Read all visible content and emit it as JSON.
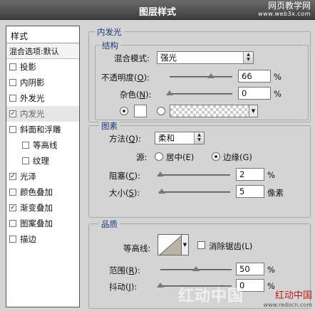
{
  "window": {
    "title": "图层样式"
  },
  "watermark_top": {
    "line1": "网页教学网",
    "line2": "www.web3x.com"
  },
  "left_panel": {
    "header": "样式",
    "blend_options": "混合选项:默认",
    "items": [
      {
        "label": "投影",
        "checked": false,
        "sub": false
      },
      {
        "label": "内阴影",
        "checked": false,
        "sub": false
      },
      {
        "label": "外发光",
        "checked": false,
        "sub": false
      },
      {
        "label": "内发光",
        "checked": true,
        "sub": false,
        "selected": true
      },
      {
        "label": "斜面和浮雕",
        "checked": false,
        "sub": false
      },
      {
        "label": "等高线",
        "checked": false,
        "sub": true
      },
      {
        "label": "纹理",
        "checked": false,
        "sub": true
      },
      {
        "label": "光泽",
        "checked": true,
        "sub": false
      },
      {
        "label": "颜色叠加",
        "checked": false,
        "sub": false
      },
      {
        "label": "渐变叠加",
        "checked": true,
        "sub": false
      },
      {
        "label": "图案叠加",
        "checked": false,
        "sub": false
      },
      {
        "label": "描边",
        "checked": false,
        "sub": false
      }
    ]
  },
  "inner_glow": {
    "title": "内发光",
    "structure": {
      "title": "结构",
      "blend_mode_label": "混合模式:",
      "blend_mode_value": "强光",
      "opacity_label": "不透明度(O):",
      "opacity_value": "66",
      "opacity_fraction": 0.66,
      "noise_label": "杂色(N):",
      "noise_value": "0",
      "noise_fraction": 0.0,
      "percent": "%"
    },
    "elements": {
      "title": "图素",
      "method_label": "方法(Q):",
      "method_value": "柔和",
      "source_label": "源:",
      "source_center": "居中(E)",
      "source_edge": "边缘(G)",
      "choke_label": "阻塞(C):",
      "choke_value": "2",
      "choke_fraction": 0.02,
      "size_label": "大小(S):",
      "size_value": "5",
      "size_unit": "像素",
      "percent": "%"
    },
    "quality": {
      "title": "品质",
      "contour_label": "等高线:",
      "anti_alias_label": "消除锯齿(L)",
      "range_label": "范围(R):",
      "range_value": "50",
      "range_fraction": 0.5,
      "jitter_label": "抖动(J):",
      "jitter_value": "0",
      "jitter_fraction": 0.0,
      "percent": "%"
    }
  },
  "watermark_bottom": {
    "line1": "红动中国",
    "line2": "www.redocn.com"
  }
}
